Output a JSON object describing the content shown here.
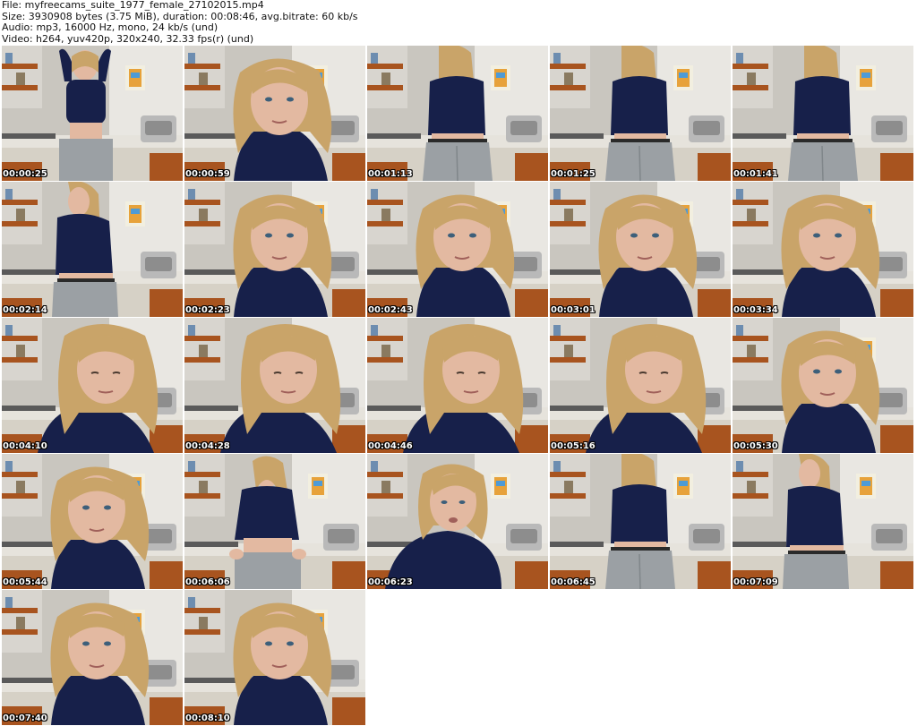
{
  "header": {
    "file": "File: myfreecams_suite_1977_female_27102015.mp4",
    "size": "Size: 3930908 bytes (3.75 MiB), duration: 00:08:46, avg.bitrate: 60 kb/s",
    "audio": "Audio: mp3, 16000 Hz, mono, 24 kb/s (und)",
    "video": "Video: h264, yuv420p, 320x240, 32.33 fps(r) (und)"
  },
  "thumbnails": [
    {
      "time": "00:00:25",
      "pose": "standing-arms-up"
    },
    {
      "time": "00:00:59",
      "pose": "close-face"
    },
    {
      "time": "00:01:13",
      "pose": "back-turned"
    },
    {
      "time": "00:01:25",
      "pose": "back-turned"
    },
    {
      "time": "00:01:41",
      "pose": "back-turned"
    },
    {
      "time": "00:02:14",
      "pose": "side-turned"
    },
    {
      "time": "00:02:23",
      "pose": "close-face"
    },
    {
      "time": "00:02:43",
      "pose": "close-face"
    },
    {
      "time": "00:03:01",
      "pose": "close-face"
    },
    {
      "time": "00:03:34",
      "pose": "close-face"
    },
    {
      "time": "00:04:10",
      "pose": "close-face-low"
    },
    {
      "time": "00:04:28",
      "pose": "close-face-low"
    },
    {
      "time": "00:04:46",
      "pose": "close-face-low"
    },
    {
      "time": "00:05:16",
      "pose": "close-face-low"
    },
    {
      "time": "00:05:30",
      "pose": "close-face"
    },
    {
      "time": "00:05:44",
      "pose": "close-face"
    },
    {
      "time": "00:06:06",
      "pose": "standing-hands-hips"
    },
    {
      "time": "00:06:23",
      "pose": "leaning-forward"
    },
    {
      "time": "00:06:45",
      "pose": "back-turned"
    },
    {
      "time": "00:07:09",
      "pose": "side-turned"
    },
    {
      "time": "00:07:40",
      "pose": "close-face"
    },
    {
      "time": "00:08:10",
      "pose": "close-face"
    }
  ],
  "colors": {
    "wall": "#c9c6bf",
    "cabinet": "#a8541f",
    "counter": "#e6e3dc",
    "shirt": "#17204a",
    "pants": "#9ba0a4",
    "hair": "#c9a469",
    "skin": "#e3b9a1"
  }
}
